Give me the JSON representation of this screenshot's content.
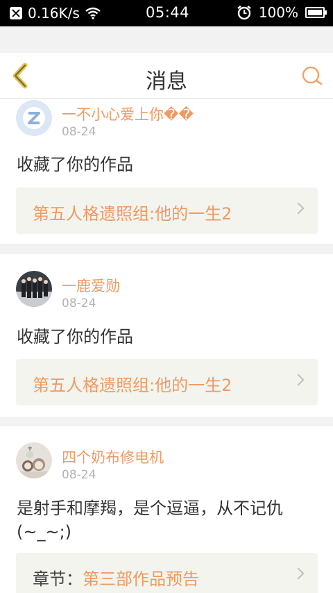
{
  "status_bar": {
    "net_speed": "0.16K/s",
    "time": "05:44",
    "battery": "100%",
    "battery_level": 1.0
  },
  "header": {
    "title": "消息",
    "back_icon": "chevron-left-icon",
    "search_icon": "search-icon"
  },
  "messages": [
    {
      "username": "一不小心爱上你��",
      "date": "08-24",
      "text": "收藏了你的作品",
      "work_title": "第五人格遗照组:他的一生2"
    },
    {
      "username": "一鹿爱勋",
      "date": "08-24",
      "text": "收藏了你的作品",
      "work_title": "第五人格遗照组:他的一生2"
    },
    {
      "username": "四个奶布修电机",
      "date": "08-24",
      "text": "是射手和摩羯，是个逗逼，从不记仇(~_~;)",
      "work_prefix": "章节：",
      "work_title": "第三部作品预告"
    }
  ],
  "colors": {
    "accent": "#ef9a62",
    "back_icon": "#e9c54b",
    "search_icon": "#f1a36a"
  }
}
